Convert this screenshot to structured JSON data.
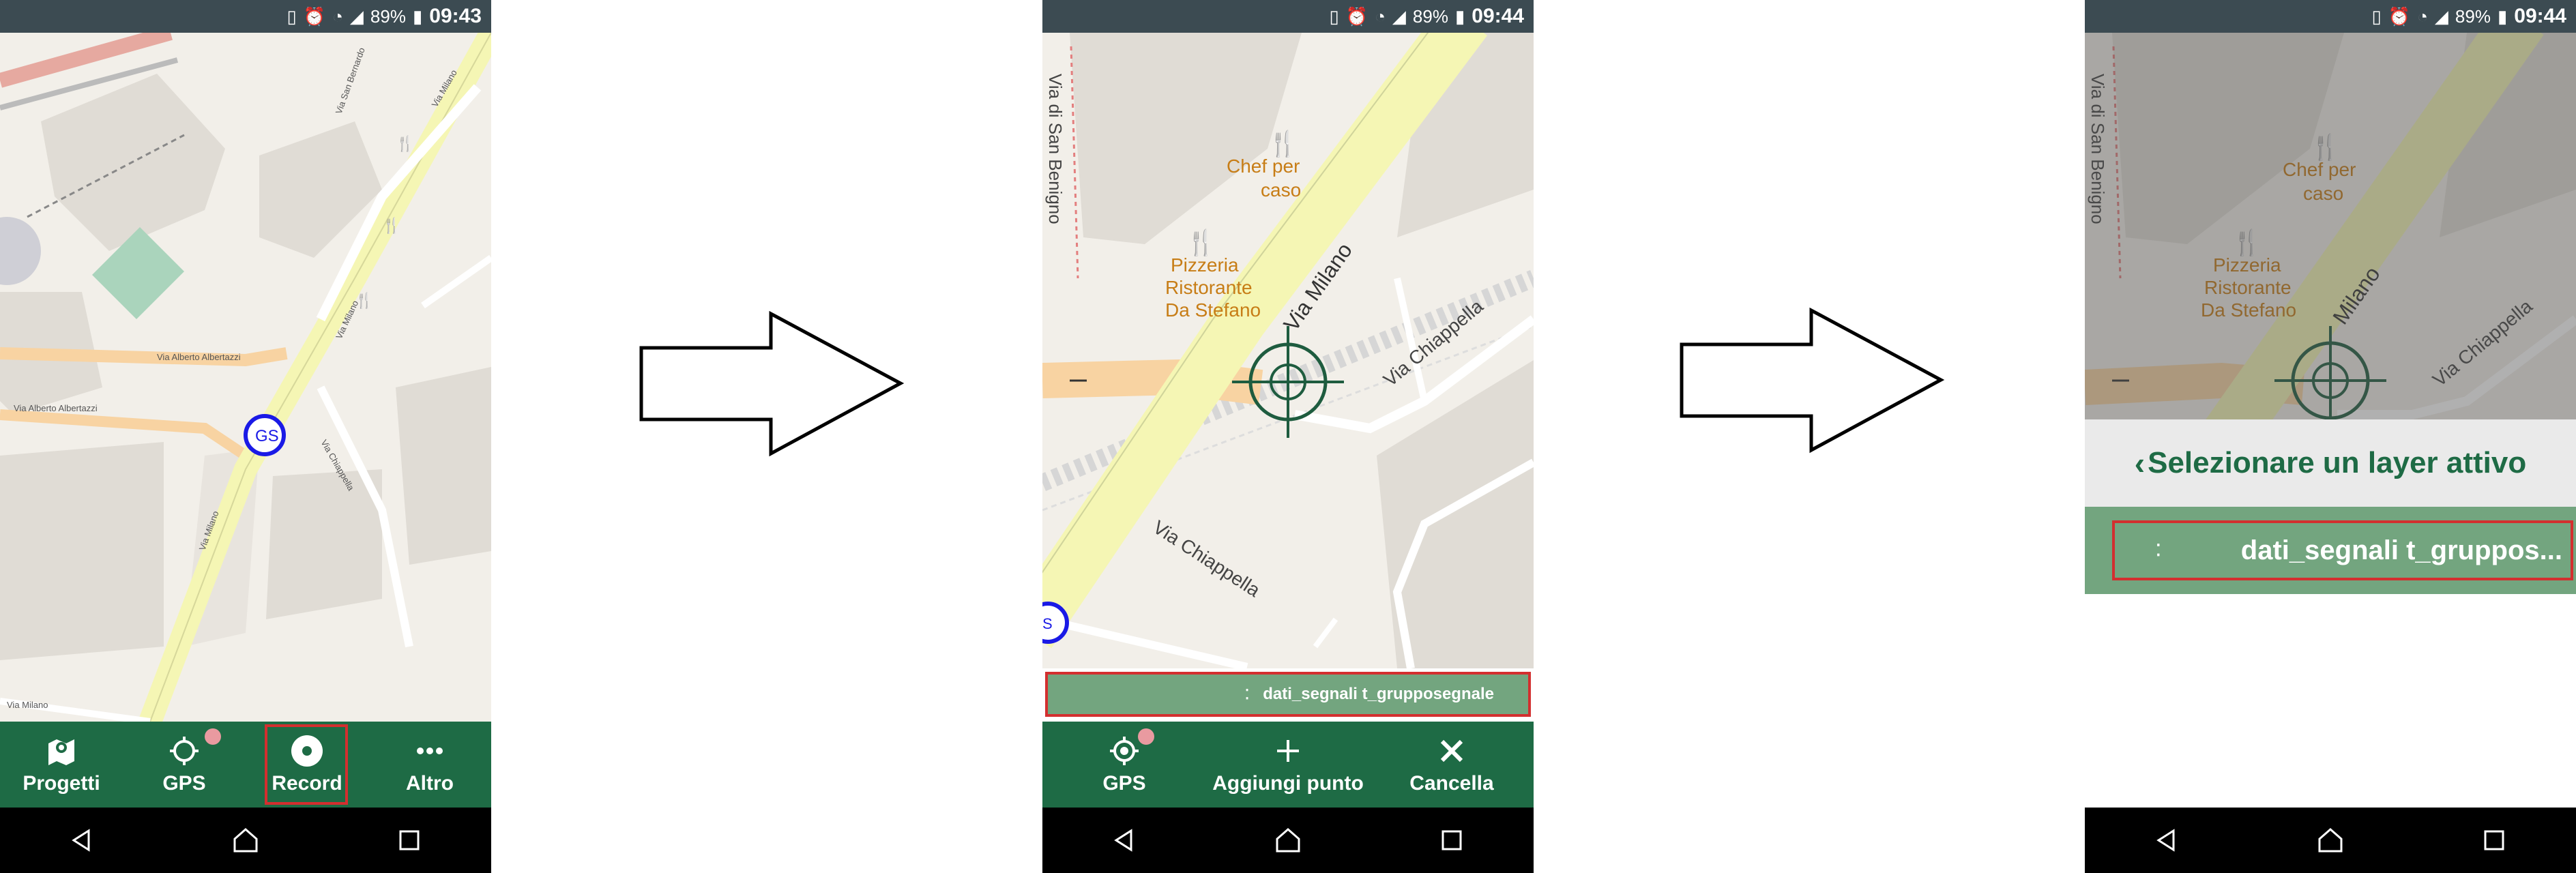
{
  "status": {
    "battery": "89%",
    "times": [
      "09:43",
      "09:44",
      "09:44"
    ]
  },
  "screen1": {
    "map_labels": [
      "Via Alberto Albertazzi",
      "Via Alberto Albertazzi",
      "Via Milano",
      "Via Chiappella",
      "Via San Bernardo",
      "Via Milano",
      "Via Milano",
      "Via Milano"
    ],
    "marker": "GS",
    "toolbar": [
      {
        "label": "Progetti",
        "icon": "map-icon"
      },
      {
        "label": "GPS",
        "icon": "gps-crosshair-icon"
      },
      {
        "label": "Record",
        "icon": "record-icon"
      },
      {
        "label": "Altro",
        "icon": "more-dots-icon"
      }
    ]
  },
  "screen2": {
    "map_labels": {
      "restaurant1": [
        "Chef per",
        "caso"
      ],
      "restaurant2": [
        "Pizzeria",
        "Ristorante",
        "Da Stefano"
      ],
      "road1": "Via Milano",
      "road2": "Via Chiappella",
      "road3": "Via Chiappella",
      "road4": "Via di San Benigno",
      "marker": "S"
    },
    "layer_label": "dati_segnali t_grupposegnale",
    "toolbar": [
      {
        "label": "GPS",
        "icon": "gps-icon"
      },
      {
        "label": "Aggiungi punto",
        "icon": "plus-icon"
      },
      {
        "label": "Cancella",
        "icon": "close-icon"
      }
    ]
  },
  "screen3": {
    "map_labels": {
      "restaurant1": [
        "Chef per",
        "caso"
      ],
      "restaurant2": [
        "Pizzeria",
        "Ristorante",
        "Da Stefano"
      ],
      "road1": "Milano",
      "road2": "Via Chiappella",
      "road4": "Via di San Benigno"
    },
    "dialog_title": "Selezionare un layer attivo",
    "layer_item": "dati_segnali t_gruppos..."
  },
  "colors": {
    "primary": "#1e6b45",
    "status_bar": "#3c4b52",
    "highlight": "#d32f2f",
    "layer_green": "#73a57f",
    "road_yellow": "#f5f6b4",
    "road_orange": "#f8d3a2"
  }
}
